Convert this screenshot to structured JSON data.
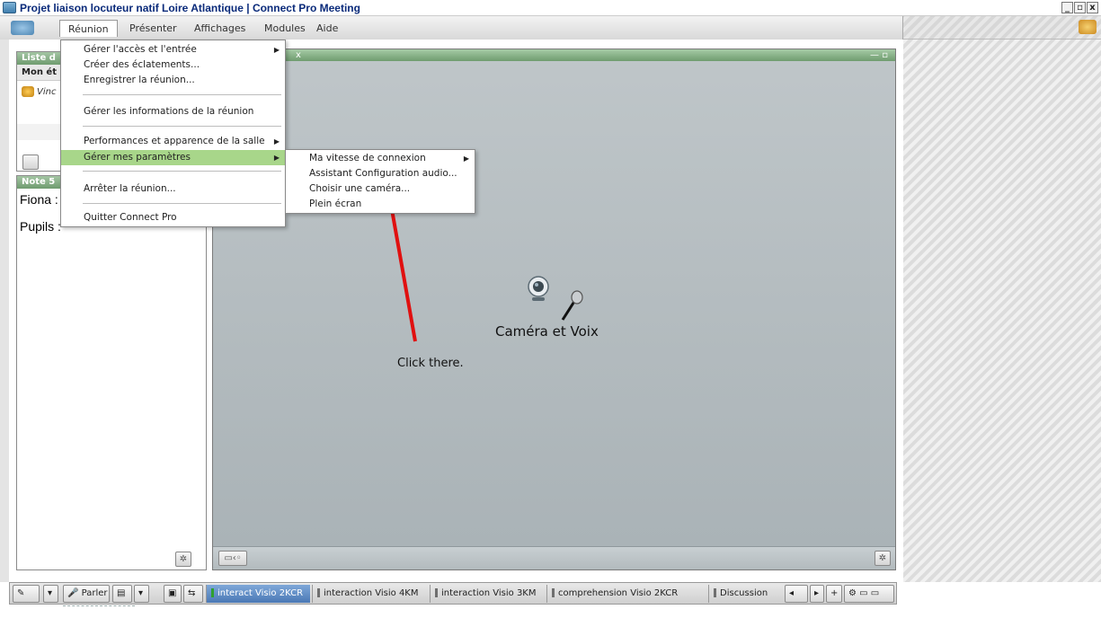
{
  "window": {
    "title": "Projet liaison locuteur natif Loire Atlantique | Connect Pro Meeting",
    "minimize": "_",
    "maximize": "▫",
    "close": "x"
  },
  "menubar": {
    "items": [
      "Réunion",
      "Présenter",
      "Affichages",
      "Modules",
      "Aide"
    ]
  },
  "attendees_panel": {
    "header": "Liste d",
    "subheader": "Mon ét",
    "attendee": "Vinc"
  },
  "notes_panel": {
    "header": "Note 5",
    "lines": [
      "Fiona :",
      "Pupils :"
    ]
  },
  "pod": {
    "header_suffix": "x",
    "window_controls": "— ▫",
    "title": "Caméra et Voix"
  },
  "reunion_menu": {
    "items": [
      {
        "label": "Gérer l'accès et l'entrée",
        "submenu": true
      },
      {
        "label": "Créer des éclatements...",
        "submenu": false
      },
      {
        "label": "Enregistrer la réunion...",
        "submenu": false
      },
      {
        "label": "Gérer les informations de la réunion",
        "submenu": false
      },
      {
        "label": "Performances et apparence de la salle",
        "submenu": true
      },
      {
        "label": "Gérer mes paramètres",
        "submenu": true,
        "highlighted": true
      },
      {
        "label": "Arrêter la réunion...",
        "submenu": false
      },
      {
        "label": "Quitter Connect Pro",
        "submenu": false
      }
    ]
  },
  "settings_submenu": {
    "items": [
      {
        "label": "Ma vitesse de connexion",
        "submenu": true
      },
      {
        "label": "Assistant Configuration audio...",
        "submenu": false
      },
      {
        "label": "Choisir une caméra...",
        "submenu": false
      },
      {
        "label": "Plein écran",
        "submenu": false
      }
    ]
  },
  "annotation": {
    "text": "Click there.",
    "arrow_color": "#e01010"
  },
  "bottombar": {
    "speak_label": "Parler",
    "tabs": [
      "interact Visio 2KCR",
      "interaction Visio 4KM",
      "interaction Visio 3KM",
      "comprehension Visio 2KCR",
      "Discussion"
    ]
  },
  "colors": {
    "pod_header": "#6f9c6f",
    "highlight": "#a8d68a",
    "title_text": "#0a2a7a"
  }
}
